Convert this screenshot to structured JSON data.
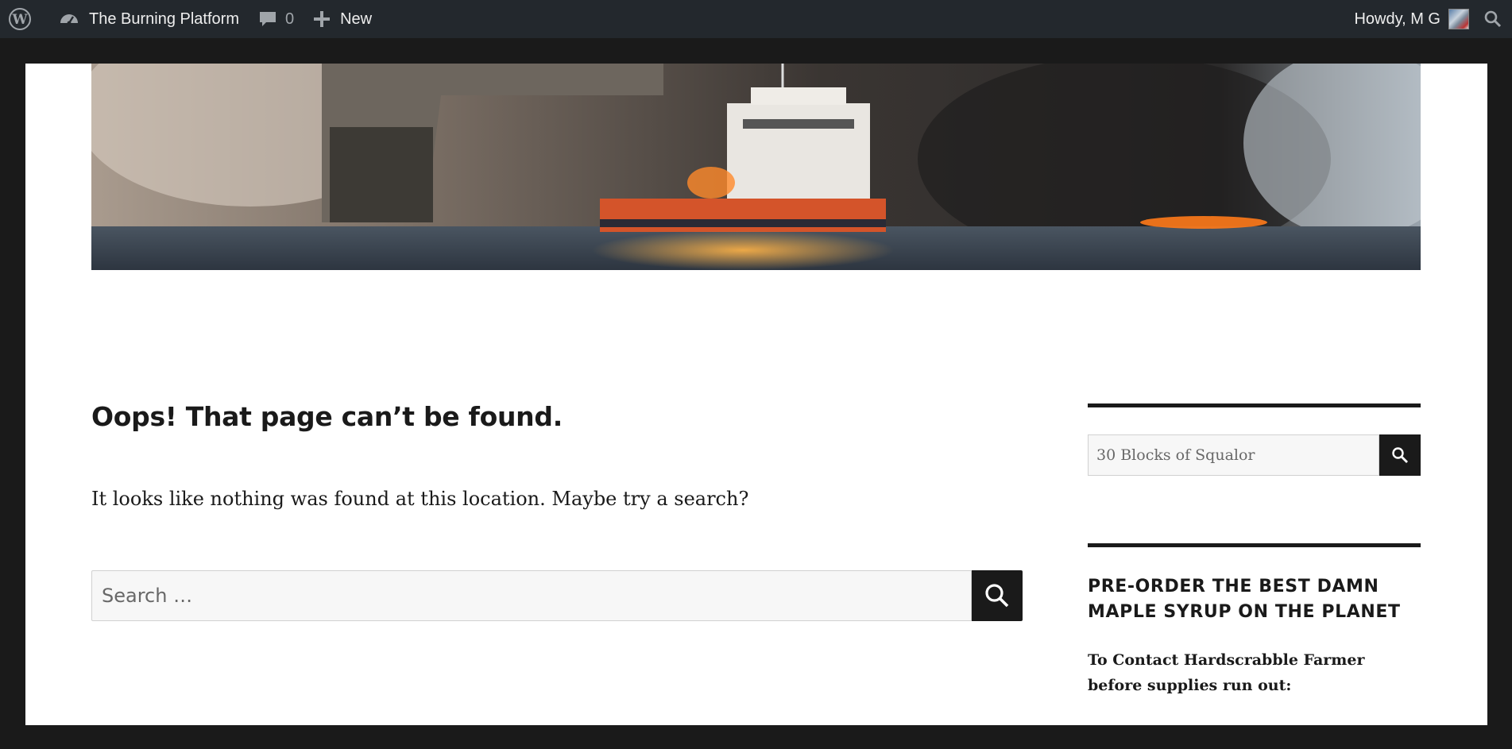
{
  "adminbar": {
    "site_name": "The Burning Platform",
    "comments_count": "0",
    "new_label": "New",
    "greeting": "Howdy, M G"
  },
  "main": {
    "title": "Oops! That page can’t be found.",
    "description": "It looks like nothing was found at this location. Maybe try a search?",
    "search_placeholder": "Search …"
  },
  "sidebar": {
    "search_value": "30 Blocks of Squalor",
    "widget_heading": "PRE-ORDER THE BEST DAMN MAPLE SYRUP ON THE PLANET",
    "widget_text": "To Contact Hardscrabble Farmer before supplies run out:"
  },
  "colors": {
    "adminbar_bg": "#23282d",
    "frame_bg": "#1a1a1a",
    "text": "#1a1a1a",
    "input_bg": "#f7f7f7"
  },
  "icons": [
    "wordpress-icon",
    "dashboard-icon",
    "comment-icon",
    "plus-icon",
    "avatar",
    "search-icon"
  ]
}
